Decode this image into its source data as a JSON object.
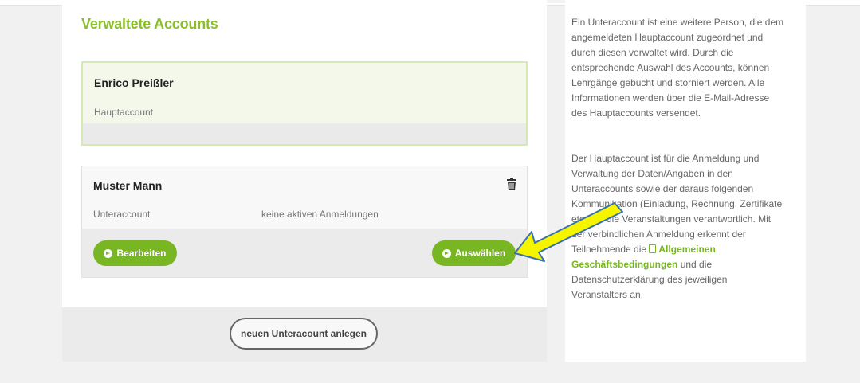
{
  "section_title": "Verwaltete Accounts",
  "accounts": [
    {
      "name": "Enrico Preißler",
      "role": "Hauptaccount"
    },
    {
      "name": "Muster Mann",
      "role": "Unteraccount",
      "status": "keine aktiven Anmeldungen",
      "edit_label": "Bearbeiten",
      "select_label": "Auswählen",
      "delete_icon": "trash-icon"
    }
  ],
  "create_button_label": "neuen Unteracount anlegen",
  "info": {
    "paragraph1": "Ein Unteraccount ist eine weitere Person, die dem angemeldeten Hauptaccount zugeordnet und durch diesen verwaltet wird. Durch die entsprechende Auswahl des Accounts, können Lehrgänge gebucht und storniert werden. Alle Informationen werden über die E-Mail-Adresse des Hauptaccounts versendet.",
    "paragraph2_before": "Der Hauptaccount ist für die Anmeldung und Verwaltung der Daten/Angaben in den Unteraccounts sowie der daraus folgenden Kommunikation (Einladung, Rechnung, Zertifikate etc.) für die Veranstaltungen verantwortlich. Mit der verbindlichen Anmeldung erkennt der Teilnehmende die",
    "terms_link": "Allgemeinen Geschäftsbedingungen",
    "paragraph2_after": "und die Datenschutzerklärung des jeweiligen Veranstalters an."
  },
  "colors": {
    "brand_green": "#79b623",
    "title_green": "#8bbf2a",
    "annotation_yellow": "#f5f500"
  }
}
